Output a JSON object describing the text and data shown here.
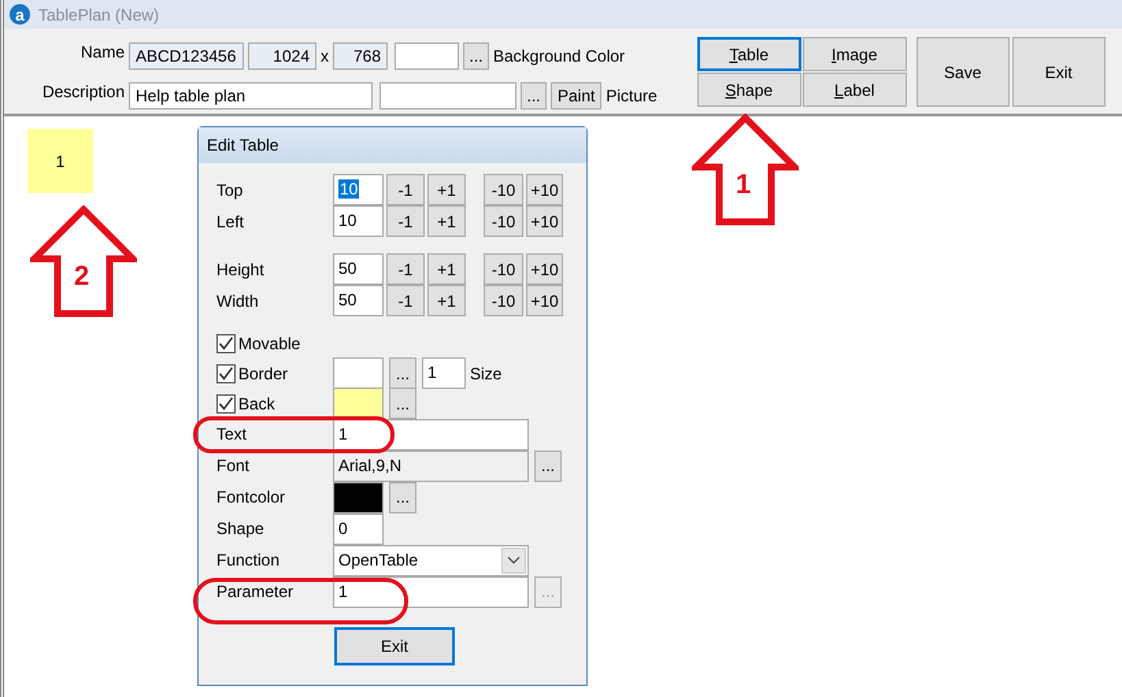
{
  "window": {
    "logo": "a",
    "title": "TablePlan (New)"
  },
  "toolbar": {
    "name_label": "Name",
    "name_value": "ABCD123456",
    "width_value": "1024",
    "times": "x",
    "height_value": "768",
    "background_button": "...",
    "background_label": "Background Color",
    "description_label": "Description",
    "description_value": "Help table plan",
    "picture_value_button": "...",
    "paint_button": "Paint",
    "picture_label": "Picture",
    "add_buttons": [
      {
        "mnemonic": "T",
        "rest": "able",
        "selected": true
      },
      {
        "mnemonic": "I",
        "rest": "mage",
        "selected": false
      },
      {
        "mnemonic": "S",
        "rest": "hape",
        "selected": false
      },
      {
        "mnemonic": "L",
        "rest": "abel",
        "selected": false
      }
    ],
    "actions": [
      "Save",
      "Exit"
    ]
  },
  "canvas": {
    "tiles": [
      {
        "text": "1",
        "color": "#ffff99"
      }
    ]
  },
  "dialog": {
    "title": "Edit Table",
    "rows": [
      {
        "kind": "spin",
        "label": "Top",
        "value": "10",
        "selected": true,
        "steps": [
          "-1",
          "+1",
          "-10",
          "+10"
        ]
      },
      {
        "kind": "spin",
        "label": "Left",
        "value": "10",
        "selected": false,
        "steps": [
          "-1",
          "+1",
          "-10",
          "+10"
        ]
      },
      {
        "kind": "spin",
        "label": "Height",
        "value": "50",
        "selected": false,
        "steps": [
          "-1",
          "+1",
          "-10",
          "+10"
        ],
        "gap_before": true
      },
      {
        "kind": "spin",
        "label": "Width",
        "value": "50",
        "selected": false,
        "steps": [
          "-1",
          "+1",
          "-10",
          "+10"
        ]
      },
      {
        "kind": "check",
        "label": "Movable",
        "checked": true,
        "gap_before": true
      },
      {
        "kind": "check",
        "label": "Border",
        "checked": true,
        "color": "#ffffff",
        "button": "...",
        "size_value": "1",
        "size_label": "Size"
      },
      {
        "kind": "check",
        "label": "Back",
        "checked": true,
        "color": "#ffff99",
        "button": "..."
      },
      {
        "kind": "text",
        "label": "Text",
        "value": "1"
      },
      {
        "kind": "text",
        "label": "Font",
        "value": "Arial,9,N",
        "readonly": true,
        "button": "...",
        "disabled_button": false
      },
      {
        "kind": "color",
        "label": "Fontcolor",
        "color": "#000000",
        "button": "..."
      },
      {
        "kind": "short",
        "label": "Shape",
        "value": "0"
      },
      {
        "kind": "select",
        "label": "Function",
        "value": "OpenTable"
      },
      {
        "kind": "text",
        "label": "Parameter",
        "value": "1",
        "readonly": false,
        "button": "...",
        "disabled_button": true
      }
    ],
    "exit_button": "Exit"
  },
  "annotations": [
    {
      "kind": "arrow",
      "label": "1"
    },
    {
      "kind": "arrow",
      "label": "2"
    },
    {
      "kind": "oval"
    },
    {
      "kind": "oval"
    }
  ]
}
